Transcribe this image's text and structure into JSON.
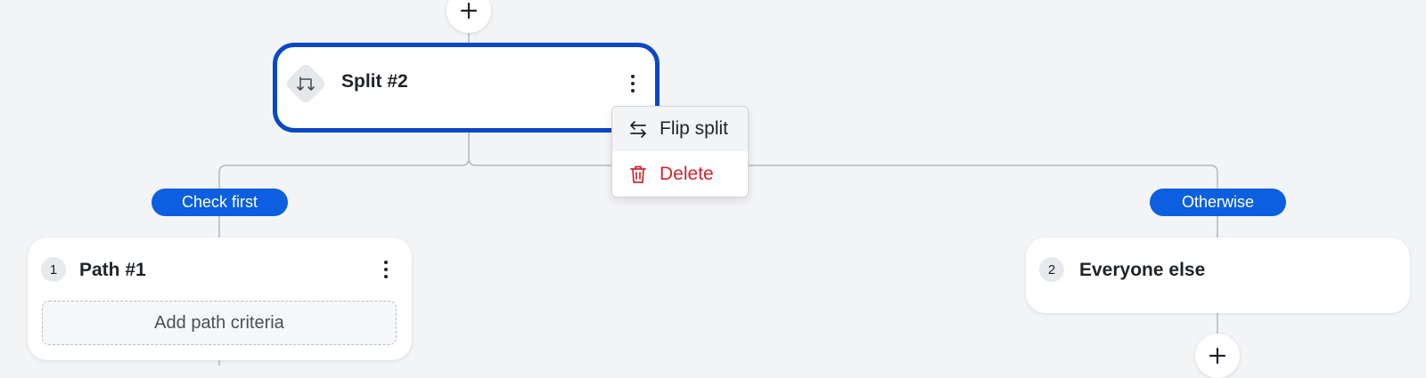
{
  "split_node": {
    "title": "Split #2"
  },
  "menu": {
    "flip_label": "Flip split",
    "delete_label": "Delete"
  },
  "branches": {
    "first_label": "Check first",
    "otherwise_label": "Otherwise"
  },
  "paths": [
    {
      "number": "1",
      "title": "Path #1",
      "criteria_button": "Add path criteria"
    },
    {
      "number": "2",
      "title": "Everyone else"
    }
  ],
  "icons": {
    "add": "plus-icon",
    "split": "split-icon",
    "more": "more-vertical-icon",
    "flip": "swap-arrows-icon",
    "delete": "trash-icon"
  },
  "colors": {
    "selected_border": "#0b47c6",
    "pill": "#0b5fe0",
    "danger": "#d1242f",
    "canvas": "#f3f4f6"
  }
}
